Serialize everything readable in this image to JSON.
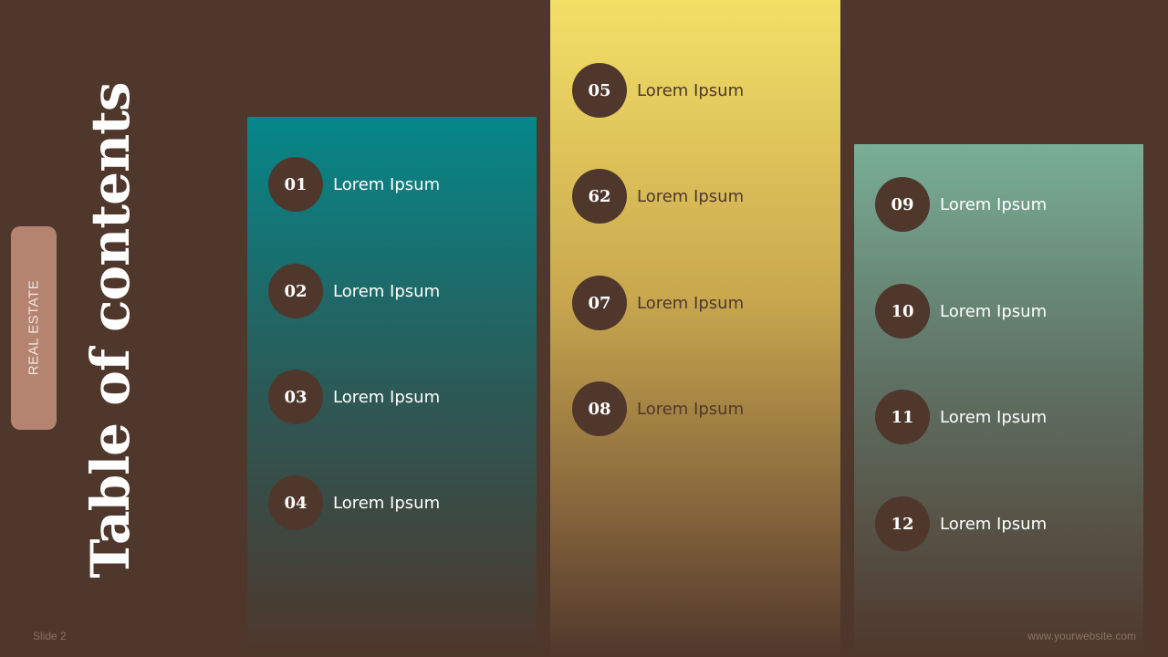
{
  "tag": "REAL ESTATE",
  "title": "Table of contents",
  "columns": [
    {
      "items": [
        {
          "number": "01",
          "label": "Lorem Ipsum"
        },
        {
          "number": "02",
          "label": "Lorem Ipsum"
        },
        {
          "number": "03",
          "label": "Lorem Ipsum"
        },
        {
          "number": "04",
          "label": "Lorem Ipsum"
        }
      ]
    },
    {
      "items": [
        {
          "number": "05",
          "label": "Lorem Ipsum"
        },
        {
          "number": "62",
          "label": "Lorem Ipsum"
        },
        {
          "number": "07",
          "label": "Lorem Ipsum"
        },
        {
          "number": "08",
          "label": "Lorem Ipsum"
        }
      ]
    },
    {
      "items": [
        {
          "number": "09",
          "label": "Lorem Ipsum"
        },
        {
          "number": "10",
          "label": "Lorem Ipsum"
        },
        {
          "number": "11",
          "label": "Lorem Ipsum"
        },
        {
          "number": "12",
          "label": "Lorem Ipsum"
        }
      ]
    }
  ],
  "footer": {
    "slide": "Slide 2",
    "website": "www.yourwebsite.com"
  },
  "colors": {
    "background": "#4f372c",
    "teal": "#05878a",
    "yellow": "#f3e067",
    "sage": "#79ae97",
    "tag": "#b58470"
  }
}
